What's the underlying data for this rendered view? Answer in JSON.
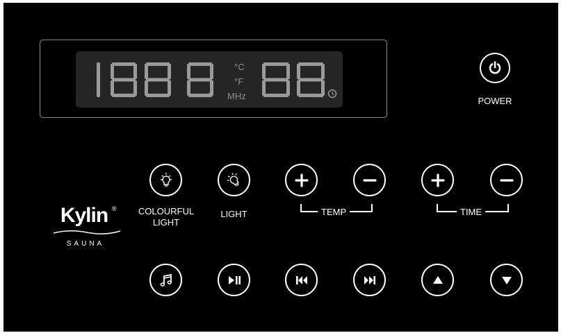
{
  "display": {
    "left_digits": [
      "8",
      "8",
      "8",
      "8"
    ],
    "right_digits": [
      "8",
      "8"
    ],
    "units": {
      "celsius": "°C",
      "fahrenheit": "°F",
      "frequency": "MHz"
    },
    "timer_icon": "clock-icon",
    "segment_color": "#9a9a9a",
    "lcd_color": "#262626"
  },
  "power": {
    "icon": "power-icon",
    "label": "POWER"
  },
  "brand": {
    "name": "Kylin",
    "registered": "®",
    "subtitle": "SAUNA"
  },
  "buttons_row1": [
    {
      "id": "colourful-light",
      "icon": "colorful-bulb-icon",
      "label": "COLOURFUL\nLIGHT"
    },
    {
      "id": "light",
      "icon": "bulb-icon",
      "label": "LIGHT"
    },
    {
      "id": "temp-plus",
      "icon": "plus-icon"
    },
    {
      "id": "temp-minus",
      "icon": "minus-icon"
    },
    {
      "id": "time-plus",
      "icon": "plus-icon"
    },
    {
      "id": "time-minus",
      "icon": "minus-icon"
    }
  ],
  "groups": {
    "temp": "TEMP",
    "time": "TIME"
  },
  "buttons_row2": [
    {
      "id": "music",
      "icon": "music-icon"
    },
    {
      "id": "play-pause",
      "icon": "play-pause-icon"
    },
    {
      "id": "previous",
      "icon": "previous-track-icon"
    },
    {
      "id": "next",
      "icon": "next-track-icon"
    },
    {
      "id": "up",
      "icon": "up-arrow-icon"
    },
    {
      "id": "down",
      "icon": "down-arrow-icon"
    }
  ],
  "colors": {
    "background": "#000000",
    "foreground": "#ffffff",
    "frame": "#8a8a8a"
  }
}
